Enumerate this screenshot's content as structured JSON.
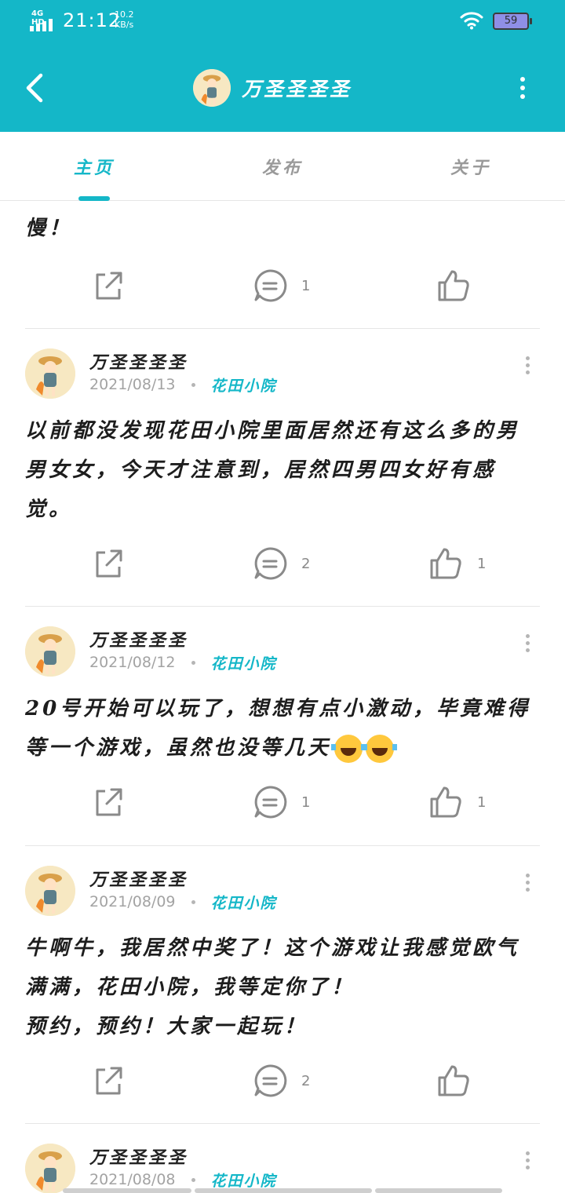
{
  "status_bar": {
    "network": "4G HD",
    "time": "21:12",
    "speed_value": "10.2",
    "speed_unit": "KB/s",
    "battery": "59"
  },
  "header": {
    "title": "万圣圣圣圣"
  },
  "tabs": [
    {
      "label": "主页"
    },
    {
      "label": "发布"
    },
    {
      "label": "关于"
    }
  ],
  "partial_post": {
    "text": "慢！",
    "comments": "1",
    "likes": ""
  },
  "posts": [
    {
      "author": "万圣圣圣圣",
      "date": "2021/08/13",
      "tag": "花田小院",
      "text": "以前都没发现花田小院里面居然还有这么多的男男女女，今天才注意到，居然四男四女好有感觉。",
      "comments": "2",
      "likes": "1"
    },
    {
      "author": "万圣圣圣圣",
      "date": "2021/08/12",
      "tag": "花田小院",
      "text": "20号开始可以玩了，想想有点小激动，毕竟难得等一个游戏，虽然也没等几天",
      "emoji": "laughing-tears-emoji",
      "comments": "1",
      "likes": "1"
    },
    {
      "author": "万圣圣圣圣",
      "date": "2021/08/09",
      "tag": "花田小院",
      "text": "牛啊牛，我居然中奖了！这个游戏让我感觉欧气满满，花田小院，我等定你了！\n预约，预约！大家一起玩！",
      "comments": "2",
      "likes": ""
    },
    {
      "author": "万圣圣圣圣",
      "date": "2021/08/08",
      "tag": "花田小院"
    }
  ],
  "colors": {
    "accent": "#14b7c8",
    "text": "#1d1d1d",
    "muted": "#a3a3a3",
    "icon": "#8a8a8a"
  },
  "icons": {
    "share": "share-icon",
    "comment": "comment-icon",
    "like": "thumbs-up-icon",
    "more": "more-vertical-icon",
    "back": "back-arrow-icon"
  }
}
